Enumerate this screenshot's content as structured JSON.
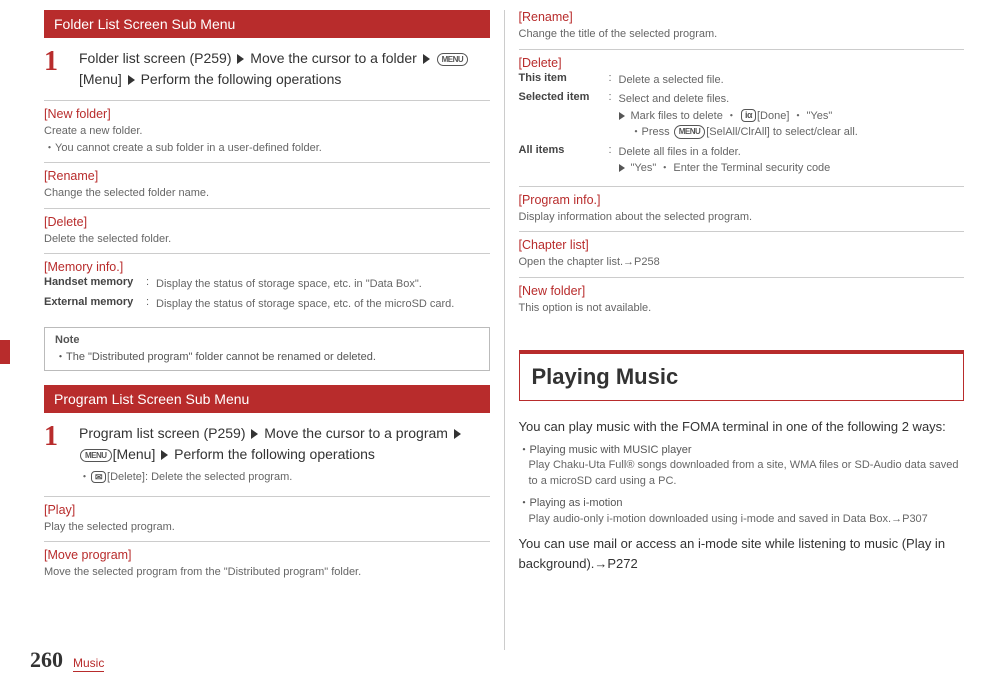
{
  "left": {
    "bar1": "Folder List Screen Sub Menu",
    "step1a": "Folder list screen (P259) ",
    "step1b": " Move the cursor to a folder ",
    "step1c": "[Menu] ",
    "step1d": " Perform the following operations",
    "newfolder_h": "[New folder]",
    "newfolder_1": "Create a new folder.",
    "newfolder_2": "・You cannot create a sub folder in a user-defined folder.",
    "rename_h": "[Rename]",
    "rename_1": "Change the selected folder name.",
    "delete_h": "[Delete]",
    "delete_1": "Delete the selected folder.",
    "mem_h": "[Memory info.]",
    "mem_t1": "Handset memory",
    "mem_d1": "Display the status of storage space, etc. in \"Data Box\".",
    "mem_t2": "External memory",
    "mem_d2": "Display the status of storage space, etc. of the microSD card.",
    "note_h": "Note",
    "note_1": "・The \"Distributed program\" folder cannot be renamed or deleted.",
    "bar2": "Program List Screen Sub Menu",
    "step2a": "Program list screen (P259) ",
    "step2b": " Move the cursor to a program ",
    "step2c": "[Menu] ",
    "step2d": " Perform the following operations",
    "step2sub": "[Delete]: Delete the selected program.",
    "play_h": "[Play]",
    "play_1": "Play the selected program.",
    "move_h": "[Move program]",
    "move_1": "Move the selected program from the \"Distributed program\" folder."
  },
  "right": {
    "rename_h": "[Rename]",
    "rename_1": "Change the title of the selected program.",
    "delete_h": "[Delete]",
    "del_t1": "This item",
    "del_d1": "Delete a selected file.",
    "del_t2": "Selected item",
    "del_d2a": "Select and delete files.",
    "del_d2b": "Mark files to delete ・ ",
    "del_d2b_done": "[Done] ・ \"Yes\"",
    "del_d2c": "・Press ",
    "del_d2c_sel": "[SelAll/ClrAll] to select/clear all.",
    "del_t3": "All items",
    "del_d3a": "Delete all files in a folder.",
    "del_d3b": "\"Yes\" ・ Enter the Terminal security code",
    "prog_h": "[Program info.]",
    "prog_1": "Display information about the selected program.",
    "chap_h": "[Chapter list]",
    "chap_1": "Open the chapter list.→P258",
    "nf_h": "[New folder]",
    "nf_1": "This option is not available.",
    "h1": "Playing Music",
    "intro": "You can play music with the FOMA terminal in one of the following 2 ways:",
    "b1t": "・Playing music with MUSIC player",
    "b1d": "Play Chaku-Uta Full® songs downloaded from a site, WMA files or SD-Audio data saved to a microSD card using a PC.",
    "b2t": "・Playing as i-motion",
    "b2d": "Play audio-only i-motion downloaded using i-mode and saved in Data Box.→P307",
    "outro": "You can use mail or access an i-mode site while listening to music (Play in background).→P272"
  },
  "footer": {
    "page": "260",
    "section": "Music"
  },
  "icons": {
    "menu": "MENU",
    "ir": "iα",
    "del": "✉"
  }
}
